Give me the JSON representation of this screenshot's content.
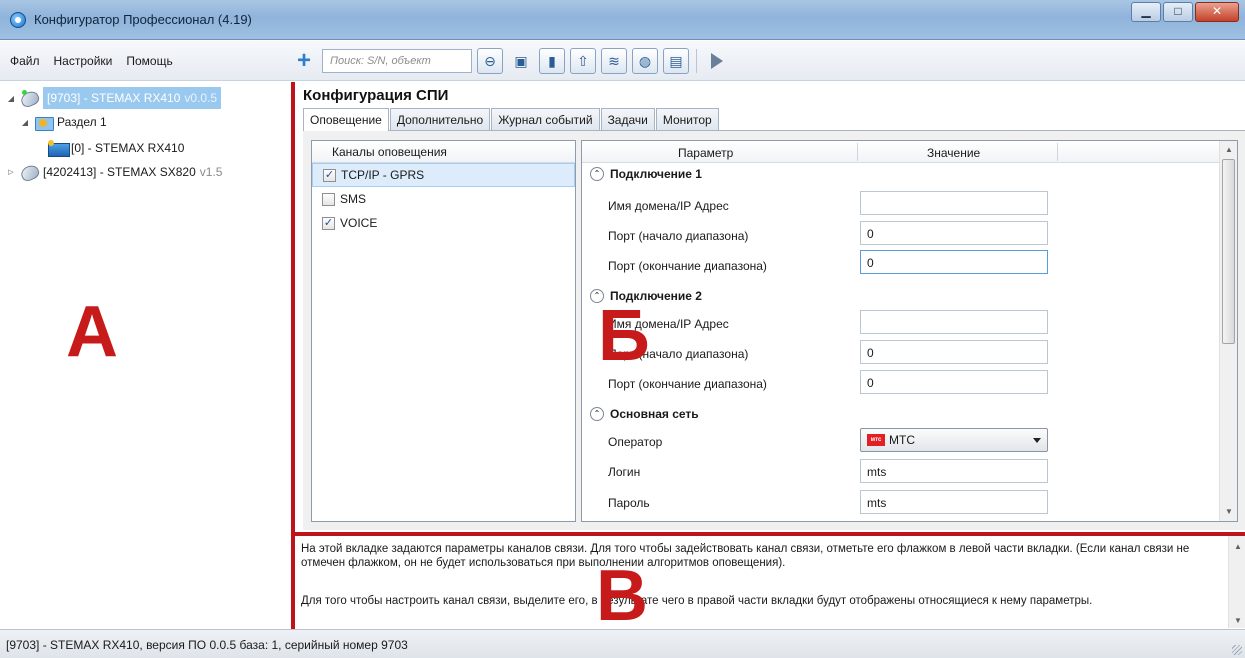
{
  "window": {
    "title": "Конфигуратор Профессионал (4.19)",
    "minimize": "▁",
    "maximize": "□",
    "close": "✕"
  },
  "menu": [
    "Файл",
    "Настройки",
    "Помощь"
  ],
  "toolbar": {
    "add": "+",
    "search_placeholder": "Поиск: S/N, объект"
  },
  "tree": [
    {
      "label": "[9703] - STEMAX RX410",
      "version": "v0.0.5"
    },
    {
      "label": "Раздел 1"
    },
    {
      "label": "[0] - STEMAX RX410"
    },
    {
      "label": "[4202413] - STEMAX SX820",
      "version": "v1.5"
    }
  ],
  "markers": {
    "a": "А",
    "b": "Б",
    "v": "В"
  },
  "panel": {
    "title": "Конфигурация СПИ",
    "tabs": [
      "Оповещение",
      "Дополнительно",
      "Журнал событий",
      "Задачи",
      "Монитор"
    ]
  },
  "channels": {
    "header": "Каналы оповещения",
    "items": [
      {
        "label": "TCP/IP - GPRS",
        "checked": true
      },
      {
        "label": "SMS",
        "checked": false
      },
      {
        "label": "VOICE",
        "checked": true
      }
    ]
  },
  "params": {
    "header_param": "Параметр",
    "header_value": "Значение",
    "groups": [
      {
        "title": "Подключение 1",
        "rows": [
          {
            "label": "Имя домена/IP Адрес",
            "value": ""
          },
          {
            "label": "Порт (начало диапазона)",
            "value": "0"
          },
          {
            "label": "Порт (окончание диапазона)",
            "value": "0"
          }
        ]
      },
      {
        "title": "Подключение 2",
        "rows": [
          {
            "label": "Имя домена/IP Адрес",
            "value": ""
          },
          {
            "label": "Порт (начало диапазона)",
            "value": "0"
          },
          {
            "label": "Порт (окончание диапазона)",
            "value": "0"
          }
        ]
      },
      {
        "title": "Основная сеть",
        "rows": [
          {
            "label": "Оператор",
            "value": "МТС",
            "logo": "мтс"
          },
          {
            "label": "Логин",
            "value": "mts"
          },
          {
            "label": "Пароль",
            "value": "mts"
          }
        ]
      }
    ]
  },
  "help": {
    "p1": "На этой вкладке задаются параметры каналов связи. Для того чтобы задействовать канал связи, отметьте его флажком в левой части вкладки. (Если канал связи не отмечен флажком, он не будет использоваться при выполнении алгоритмов оповещения).",
    "p2": "Для того чтобы настроить канал связи, выделите его, в результате чего в правой части вкладки будут отображены относящиеся к нему параметры."
  },
  "status": "[9703] - STEMAX RX410, версия ПО 0.0.5 база: 1, серийный номер 9703",
  "colors": {
    "accent_red": "#c0141d",
    "selection": "#99c9ef"
  }
}
